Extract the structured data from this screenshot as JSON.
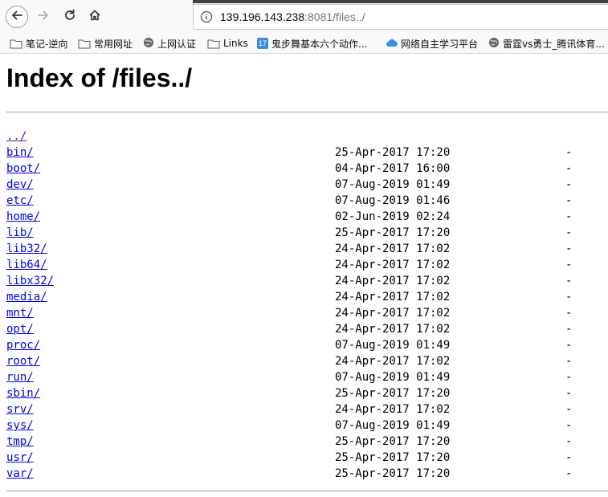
{
  "browser": {
    "url_host": "139.196.143.238",
    "url_rest": ":8081/files../",
    "icons": {
      "back": "arrow-left-icon",
      "forward": "arrow-right-icon",
      "reload": "reload-icon",
      "home": "home-icon",
      "site_info": "info-icon"
    }
  },
  "bookmarks": [
    {
      "label": "笔记-逆向",
      "icon": "folder-icon"
    },
    {
      "label": "常用网址",
      "icon": "folder-icon"
    },
    {
      "label": "上网认证",
      "icon": "globe-icon"
    },
    {
      "label": "Links",
      "icon": "folder-icon"
    },
    {
      "label": "鬼步舞基本六个动作...",
      "icon": "calendar-icon",
      "badge": "17"
    },
    {
      "label": "网络自主学习平台",
      "icon": "cloud-icon"
    },
    {
      "label": "雷霆vs勇士_腾讯体育...",
      "icon": "globe-icon"
    }
  ],
  "page": {
    "title": "Index of /files../",
    "parent_link": "../",
    "entries": [
      {
        "name": "bin/",
        "date": "25-Apr-2017 17:20",
        "size": "-"
      },
      {
        "name": "boot/",
        "date": "04-Apr-2017 16:00",
        "size": "-"
      },
      {
        "name": "dev/",
        "date": "07-Aug-2019 01:49",
        "size": "-"
      },
      {
        "name": "etc/",
        "date": "07-Aug-2019 01:46",
        "size": "-"
      },
      {
        "name": "home/",
        "date": "02-Jun-2019 02:24",
        "size": "-"
      },
      {
        "name": "lib/",
        "date": "25-Apr-2017 17:20",
        "size": "-"
      },
      {
        "name": "lib32/",
        "date": "24-Apr-2017 17:02",
        "size": "-"
      },
      {
        "name": "lib64/",
        "date": "24-Apr-2017 17:02",
        "size": "-"
      },
      {
        "name": "libx32/",
        "date": "24-Apr-2017 17:02",
        "size": "-"
      },
      {
        "name": "media/",
        "date": "24-Apr-2017 17:02",
        "size": "-"
      },
      {
        "name": "mnt/",
        "date": "24-Apr-2017 17:02",
        "size": "-"
      },
      {
        "name": "opt/",
        "date": "24-Apr-2017 17:02",
        "size": "-"
      },
      {
        "name": "proc/",
        "date": "07-Aug-2019 01:49",
        "size": "-"
      },
      {
        "name": "root/",
        "date": "24-Apr-2017 17:02",
        "size": "-"
      },
      {
        "name": "run/",
        "date": "07-Aug-2019 01:49",
        "size": "-"
      },
      {
        "name": "sbin/",
        "date": "25-Apr-2017 17:20",
        "size": "-"
      },
      {
        "name": "srv/",
        "date": "24-Apr-2017 17:02",
        "size": "-"
      },
      {
        "name": "sys/",
        "date": "07-Aug-2019 01:49",
        "size": "-"
      },
      {
        "name": "tmp/",
        "date": "25-Apr-2017 17:20",
        "size": "-"
      },
      {
        "name": "usr/",
        "date": "25-Apr-2017 17:20",
        "size": "-"
      },
      {
        "name": "var/",
        "date": "25-Apr-2017 17:20",
        "size": "-"
      }
    ]
  }
}
